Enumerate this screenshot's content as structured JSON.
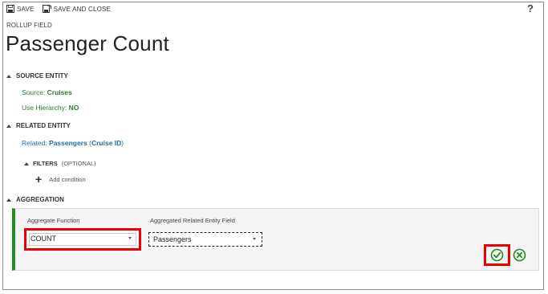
{
  "toolbar": {
    "save_label": "SAVE",
    "save_and_close_label": "SAVE AND CLOSE",
    "help_label": "?"
  },
  "header": {
    "subtitle": "ROLLUP FIELD",
    "title": "Passenger Count"
  },
  "source_entity": {
    "heading": "SOURCE ENTITY",
    "source_label": "Source: ",
    "source_value": "Cruises",
    "hierarchy_label": "Use Hierarchy: ",
    "hierarchy_value": "NO"
  },
  "related_entity": {
    "heading": "RELATED ENTITY",
    "related_label": "Related: ",
    "related_value": "Passengers",
    "related_paren_open": " (",
    "related_key": "Cruise ID",
    "related_paren_close": ")",
    "filters_heading": "FILTERS",
    "filters_optional": "(OPTIONAL)",
    "add_condition_label": "Add condition"
  },
  "aggregation": {
    "heading": "AGGREGATION",
    "function_label": "Aggregate Function",
    "function_value": "COUNT",
    "field_label": "Aggregated Related Entity Field",
    "field_value": "Passengers"
  },
  "colors": {
    "accent_green": "#1f8f1f",
    "link_blue": "#1a6fa8",
    "highlight_red": "#e00000"
  },
  "icons": {
    "save": "save-icon",
    "save_and_close": "save-close-icon",
    "confirm": "checkmark-circle-icon",
    "cancel": "close-circle-icon",
    "add": "plus-icon",
    "expand": "triangle-icon"
  }
}
